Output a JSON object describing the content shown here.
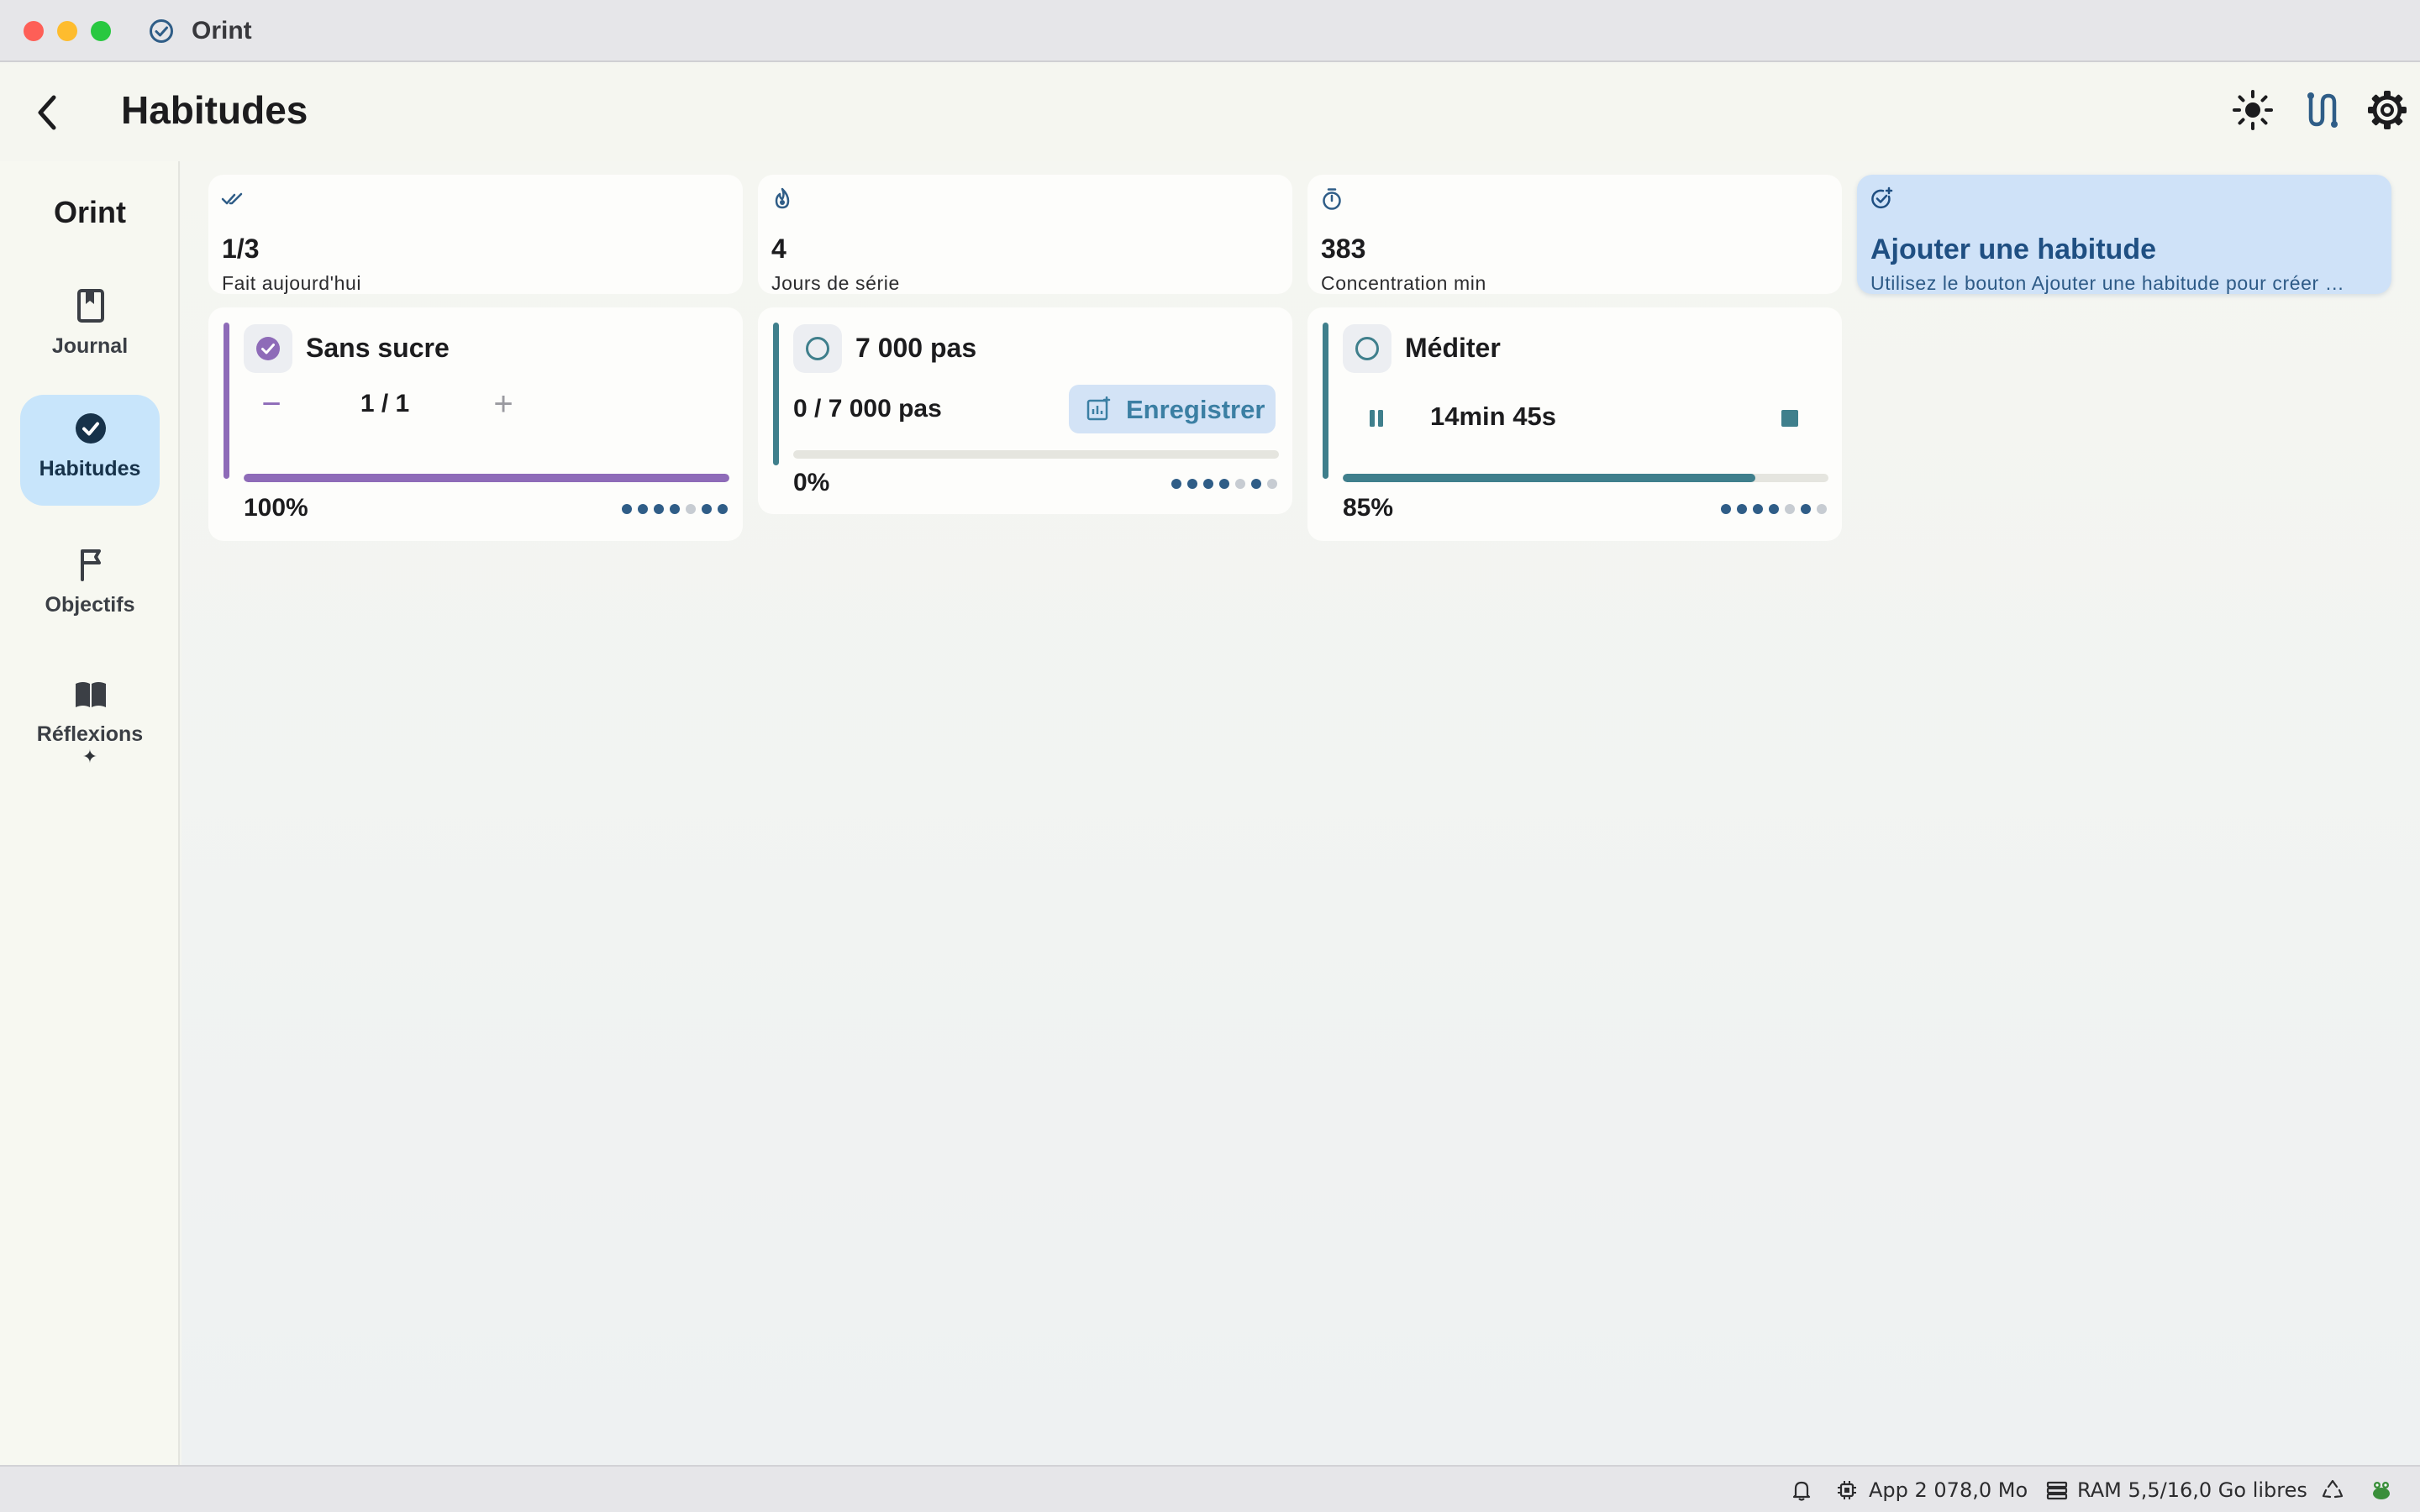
{
  "window": {
    "app_title": "Orint"
  },
  "header": {
    "title": "Habitudes"
  },
  "sidebar": {
    "brand": "Orint",
    "items": [
      {
        "label": "Journal",
        "icon": "bookmark-book-icon"
      },
      {
        "label": "Habitudes",
        "icon": "check-circle-icon",
        "active": true
      },
      {
        "label": "Objectifs",
        "icon": "flag-icon"
      },
      {
        "label": "Réflexions",
        "icon": "open-book-icon",
        "badge": "✦"
      }
    ]
  },
  "stats": [
    {
      "value": "1/3",
      "label": "Fait aujourd'hui",
      "icon": "double-check-icon"
    },
    {
      "value": "4",
      "label": "Jours de série",
      "icon": "flame-icon"
    },
    {
      "value": "383",
      "label": "Concentration min",
      "icon": "stopwatch-icon"
    },
    {
      "value": "Ajouter une habitude",
      "label": "Utilisez le bouton Ajouter une habitude pour créer …",
      "icon": "add-check-icon"
    }
  ],
  "habits": [
    {
      "name": "Sans sucre",
      "accent": "#8e6bb8",
      "done": true,
      "counter": "1 / 1",
      "minus": "−",
      "plus": "+",
      "progress": 1.0,
      "percent": "100%",
      "history": [
        "#2f5d87",
        "#2f5d87",
        "#2f5d87",
        "#2f5d87",
        "#c7ccd2",
        "#2f5d87",
        "#2f5d87"
      ]
    },
    {
      "name": "7 000 pas",
      "accent": "#3f7f8c",
      "done": false,
      "steps": "0 / 7 000 pas",
      "record_label": "Enregistrer",
      "progress": 0.0,
      "percent": "0%",
      "history": [
        "#2f5d87",
        "#2f5d87",
        "#2f5d87",
        "#2f5d87",
        "#c7ccd2",
        "#2f5d87",
        "#c7ccd2"
      ]
    },
    {
      "name": "Méditer",
      "accent": "#3f7f8c",
      "done": false,
      "timer": "14min 45s",
      "progress": 0.85,
      "percent": "85%",
      "history": [
        "#2f5d87",
        "#2f5d87",
        "#2f5d87",
        "#2f5d87",
        "#c7ccd2",
        "#2f5d87",
        "#c7ccd2"
      ]
    }
  ],
  "statusbar": {
    "app_memory": "App 2 078,0 Mo",
    "ram": "RAM 5,5/16,0 Go libres"
  },
  "colors": {
    "accent_blue": "#2f5d87",
    "purple": "#8e6bb8",
    "teal": "#3f7f8c",
    "active_nav": "#c8e5fb",
    "add_card": "#cfe2f8"
  }
}
